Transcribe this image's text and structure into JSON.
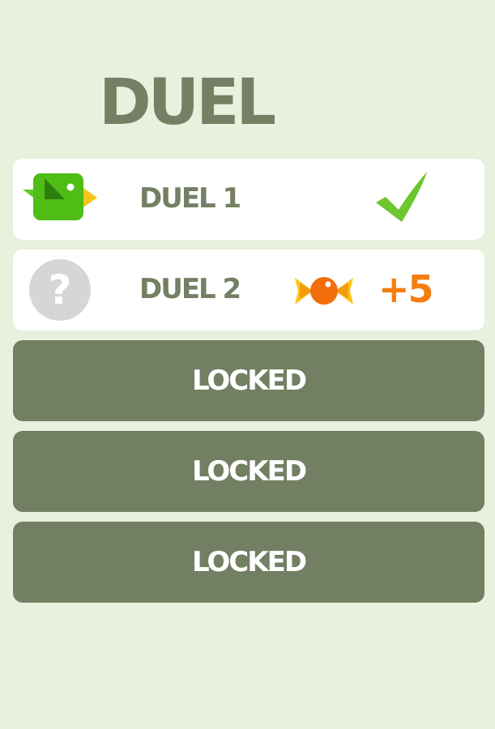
{
  "page": {
    "title": "DUEL"
  },
  "duels": [
    {
      "label": "DUEL 1",
      "status": "completed",
      "icon": "green-bird-icon",
      "status_icon": "checkmark-icon"
    },
    {
      "label": "DUEL 2",
      "status": "available",
      "icon": "question-mark-icon",
      "reward_icon": "candy-icon",
      "reward": "+5"
    }
  ],
  "locked_rows": [
    {
      "label": "LOCKED"
    },
    {
      "label": "LOCKED"
    },
    {
      "label": "LOCKED"
    }
  ],
  "colors": {
    "background": "#e8f0de",
    "text": "#747f63",
    "locked_row": "#737f62",
    "check": "#6cc62e",
    "reward": "#f57d0f",
    "bird_body": "#4fbd15",
    "bird_beak": "#f7c51a"
  }
}
